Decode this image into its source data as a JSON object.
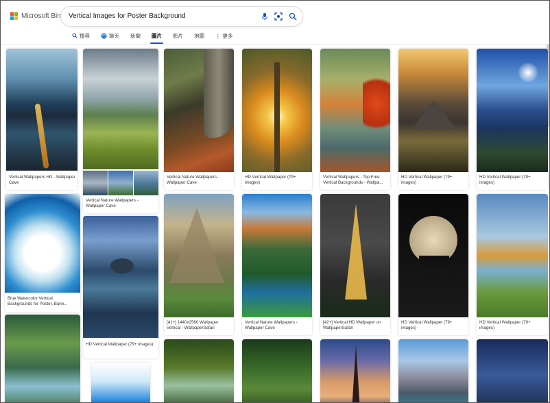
{
  "header": {
    "logo_text": "Microsoft Bing",
    "search_value": "Vertical Images for Poster Background",
    "icons": [
      "microphone-icon",
      "visual-search-icon",
      "search-icon"
    ],
    "tabs": [
      {
        "label": "搜尋",
        "icon": "search-icon"
      },
      {
        "label": "聊天",
        "icon": "copilot-chat-icon"
      },
      {
        "label": "新聞",
        "icon": ""
      },
      {
        "label": "圖片",
        "icon": "",
        "active": true
      },
      {
        "label": "影片",
        "icon": ""
      },
      {
        "label": "地圖",
        "icon": ""
      },
      {
        "label": "更多",
        "icon": "more-dots-icon"
      }
    ]
  },
  "colors": {
    "accent": "#174ae4",
    "logo": [
      "#f25022",
      "#7fba00",
      "#00a4ef",
      "#ffb900"
    ]
  },
  "results": [
    {
      "caption": "Vertical Wallpapers HD - Wallpaper Cave"
    },
    {
      "caption": "Vertical Nature Wallpapers - Wallpaper Cave"
    },
    {
      "caption": ""
    },
    {
      "caption": "HD Vertical Wallpaper (79+ images)"
    },
    {
      "caption": "Vertical Wallpapers - Top Free Vertical Backgrounds - Wallpa..."
    },
    {
      "caption": "HD Vertical Wallpaper (79+ images)"
    },
    {
      "caption": "HD Vertical Wallpaper (79+ images)"
    },
    {
      "caption": "Blue Watercolor Vertical Backgrounds for Poster, Bann..."
    },
    {
      "caption": "HD Vertical Wallpaper (79+ images)"
    },
    {
      "caption": "[41+] 1440x2560 Wallpaper Vertical - WallpaperSafari"
    },
    {
      "caption": "Vertical Nature Wallpapers - Wallpaper Cave"
    },
    {
      "caption": "[42+] Vertical HD Wallpaper on WallpaperSafari"
    },
    {
      "caption": "HD Vertical Wallpaper (79+ images)"
    },
    {
      "caption": "HD Vertical Wallpaper (79+ images)"
    }
  ]
}
